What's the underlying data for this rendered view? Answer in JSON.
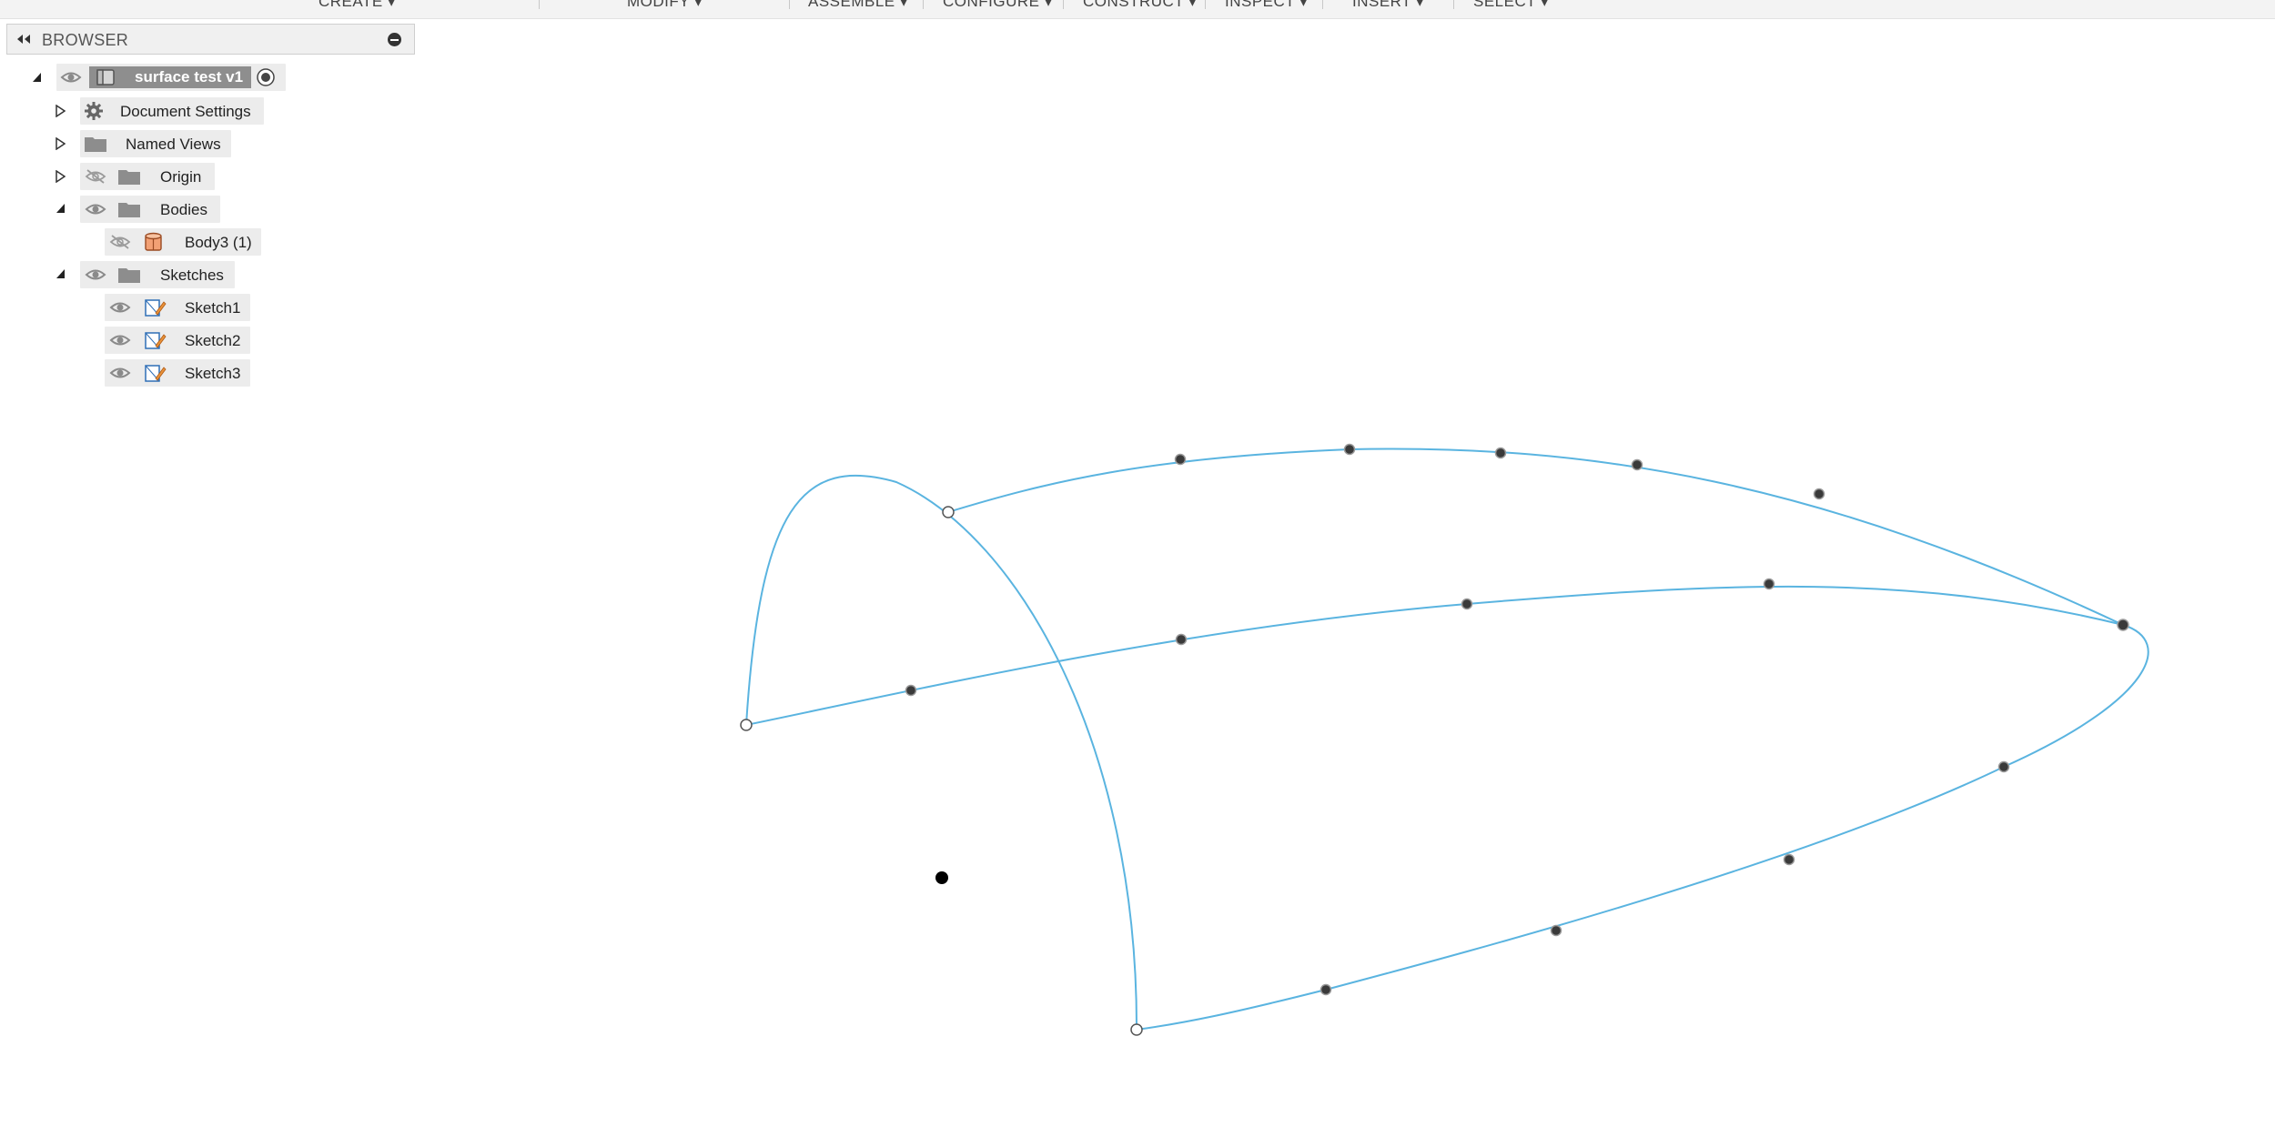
{
  "toolbar": {
    "create": "CREATE ▾",
    "modify": "MODIFY ▾",
    "assemble": "ASSEMBLE ▾",
    "configure": "CONFIGURE ▾",
    "construct": "CONSTRUCT ▾",
    "inspect": "INSPECT ▾",
    "insert": "INSERT ▾",
    "select": "SELECT ▾"
  },
  "browser": {
    "title": "BROWSER",
    "root": {
      "label": "surface test v1",
      "icon": "component-icon",
      "active_indicator": "radio-active-icon"
    },
    "items": [
      {
        "label": "Document Settings",
        "icon": "gear-icon"
      },
      {
        "label": "Named Views",
        "icon": "folder-icon"
      },
      {
        "label": "Origin",
        "icon": "folder-icon",
        "visible": false
      },
      {
        "label": "Bodies",
        "icon": "folder-icon",
        "visible": true,
        "expanded": true
      },
      {
        "label": "Body3 (1)",
        "icon": "body-icon",
        "visible": false
      },
      {
        "label": "Sketches",
        "icon": "folder-icon",
        "visible": true,
        "expanded": true
      },
      {
        "label": "Sketch1",
        "icon": "sketch-icon",
        "visible": true
      },
      {
        "label": "Sketch2",
        "icon": "sketch-icon",
        "visible": true
      },
      {
        "label": "Sketch3",
        "icon": "sketch-icon",
        "visible": true
      }
    ]
  },
  "viewport": {
    "curve_color": "#5ab4e0",
    "point_color": "#3a3a3a"
  }
}
